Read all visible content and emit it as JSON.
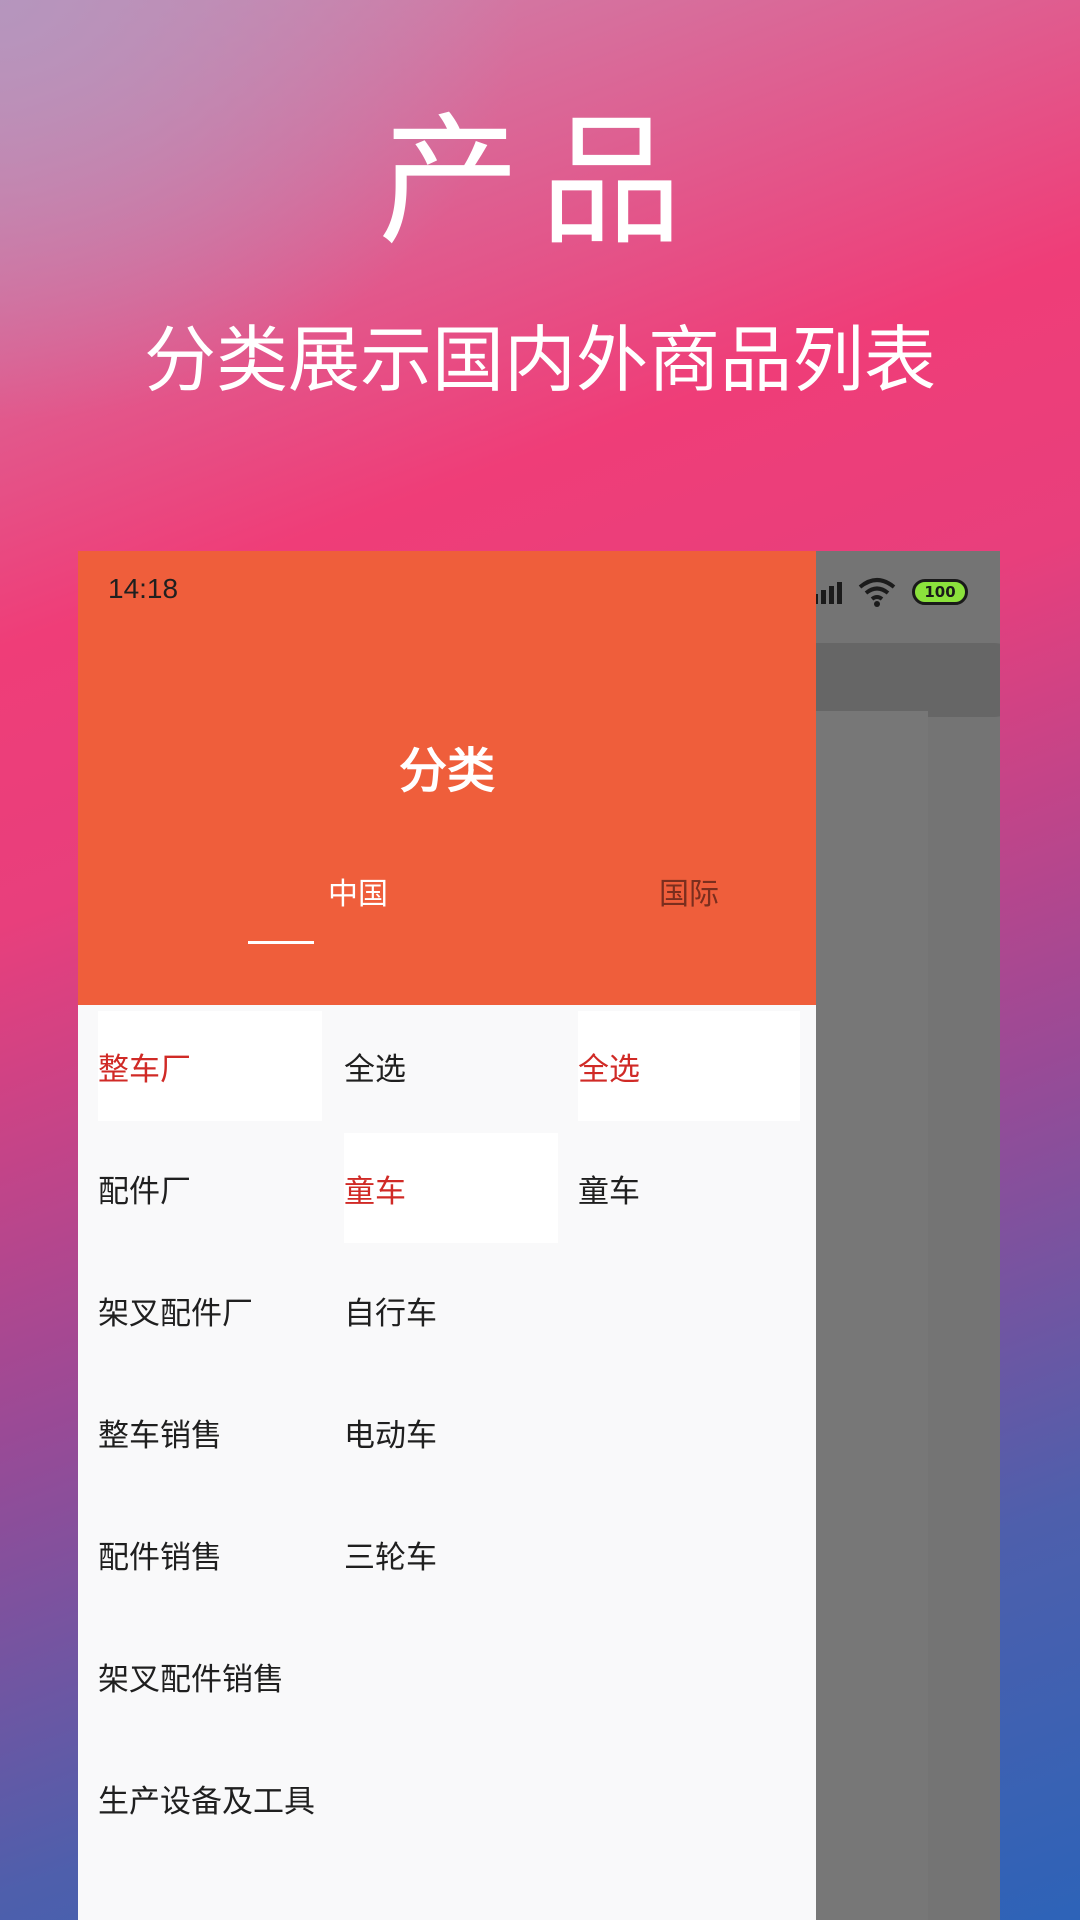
{
  "promo": {
    "title": "产品",
    "subtitle": "分类展示国内外商品列表"
  },
  "status_bar": {
    "time": "14:18",
    "battery": "100",
    "icons": [
      "signal-icon",
      "wifi-icon",
      "battery-icon"
    ]
  },
  "drawer": {
    "title": "分类",
    "tabs": [
      {
        "label": "中国",
        "selected": true
      },
      {
        "label": "国际",
        "selected": false
      }
    ],
    "column1": [
      {
        "label": "整车厂",
        "active": true
      },
      {
        "label": "配件厂",
        "active": false
      },
      {
        "label": "架叉配件厂",
        "active": false
      },
      {
        "label": "整车销售",
        "active": false
      },
      {
        "label": "配件销售",
        "active": false
      },
      {
        "label": "架叉配件销售",
        "active": false
      },
      {
        "label": "生产设备及工具",
        "active": false
      }
    ],
    "column2": [
      {
        "label": "全选",
        "active": false
      },
      {
        "label": "童车",
        "active": true
      },
      {
        "label": "自行车",
        "active": false
      },
      {
        "label": "电动车",
        "active": false
      },
      {
        "label": "三轮车",
        "active": false
      }
    ],
    "column3": [
      {
        "label": "全选",
        "active": true
      },
      {
        "label": "童车",
        "active": false
      }
    ]
  },
  "colors": {
    "header": "#ef5e3b",
    "active_text": "#d02a26",
    "overlay": "#747474"
  }
}
